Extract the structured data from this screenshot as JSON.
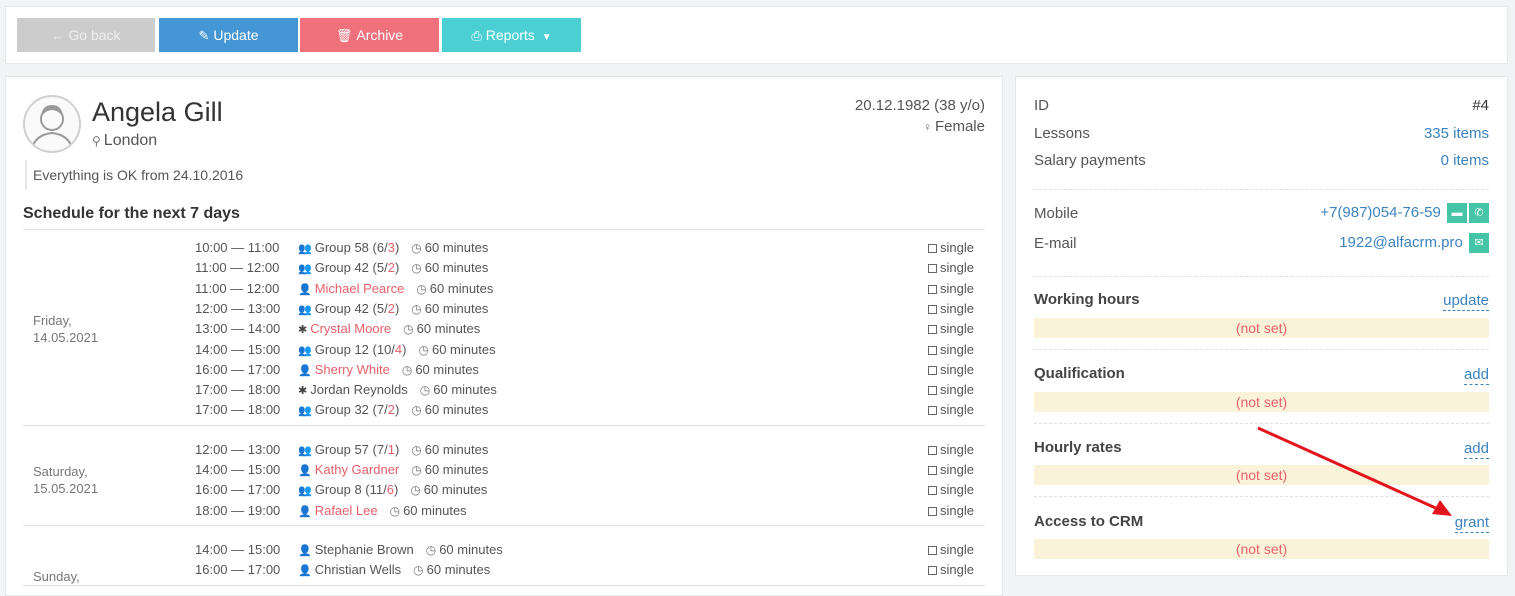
{
  "toolbar": {
    "back_label": "Go back",
    "update_label": "Update",
    "archive_label": "Archive",
    "reports_label": "Reports"
  },
  "profile": {
    "name": "Angela Gill",
    "city": "London",
    "dob": "20.12.1982 (38 y/o)",
    "gender": "Female",
    "status_note": "Everything is OK from 24.10.2016"
  },
  "schedule": {
    "title": "Schedule for the next 7 days",
    "days": [
      {
        "label_line1": "Friday,",
        "label_line2": "14.05.2021",
        "lessons": [
          {
            "time": "10:00 — 11:00",
            "icon": "group-icon",
            "name": "Group 58 (6/",
            "extra": "3",
            "suffix": ")",
            "duration": "60 minutes",
            "type": "single"
          },
          {
            "time": "11:00 — 12:00",
            "icon": "group-icon",
            "name": "Group 42 (5/",
            "extra": "2",
            "suffix": ")",
            "duration": "60 minutes",
            "type": "single"
          },
          {
            "time": "11:00 — 12:00",
            "icon": "user-icon",
            "name": "Michael Pearce",
            "red": true,
            "duration": "60 minutes",
            "type": "single"
          },
          {
            "time": "12:00 — 13:00",
            "icon": "group-icon",
            "name": "Group 42 (5/",
            "extra": "2",
            "suffix": ")",
            "duration": "60 minutes",
            "type": "single"
          },
          {
            "time": "13:00 — 14:00",
            "icon": "asterisk-icon",
            "name": "Crystal Moore",
            "red": true,
            "duration": "60 minutes",
            "type": "single"
          },
          {
            "time": "14:00 — 15:00",
            "icon": "group-icon",
            "name": "Group 12 (10/",
            "extra": "4",
            "suffix": ")",
            "duration": "60 minutes",
            "type": "single"
          },
          {
            "time": "16:00 — 17:00",
            "icon": "user-icon",
            "name": "Sherry White",
            "red": true,
            "duration": "60 minutes",
            "type": "single"
          },
          {
            "time": "17:00 — 18:00",
            "icon": "asterisk-icon",
            "name": "Jordan Reynolds",
            "duration": "60 minutes",
            "type": "single"
          },
          {
            "time": "17:00 — 18:00",
            "icon": "group-icon",
            "name": "Group 32 (7/",
            "extra": "2",
            "suffix": ")",
            "duration": "60 minutes",
            "type": "single"
          }
        ]
      },
      {
        "label_line1": "Saturday,",
        "label_line2": "15.05.2021",
        "lessons": [
          {
            "time": "12:00 — 13:00",
            "icon": "group-icon",
            "name": "Group 57 (7/",
            "extra": "1",
            "suffix": ")",
            "duration": "60 minutes",
            "type": "single"
          },
          {
            "time": "14:00 — 15:00",
            "icon": "user-icon",
            "name": "Kathy Gardner",
            "red": true,
            "duration": "60 minutes",
            "type": "single"
          },
          {
            "time": "16:00 — 17:00",
            "icon": "group-icon",
            "name": "Group 8 (11/",
            "extra": "6",
            "suffix": ")",
            "duration": "60 minutes",
            "type": "single"
          },
          {
            "time": "18:00 — 19:00",
            "icon": "user-icon",
            "name": "Rafael Lee",
            "red": true,
            "duration": "60 minutes",
            "type": "single"
          }
        ]
      },
      {
        "label_line1": "Sunday,",
        "label_line2": "",
        "lessons": [
          {
            "time": "14:00 — 15:00",
            "icon": "user-icon",
            "name": "Stephanie Brown",
            "duration": "60 minutes",
            "type": "single"
          },
          {
            "time": "16:00 — 17:00",
            "icon": "user-icon",
            "name": "Christian Wells",
            "duration": "60 minutes",
            "type": "single"
          }
        ]
      }
    ]
  },
  "details": {
    "id_label": "ID",
    "id_value": "#4",
    "lessons_label": "Lessons",
    "lessons_value": "335 items",
    "salary_label": "Salary payments",
    "salary_value": "0 items",
    "mobile_label": "Mobile",
    "mobile_value": "+7(987)054-76-59",
    "email_label": "E-mail",
    "email_value": "1922@alfacrm.pro"
  },
  "sections": {
    "working_hours": {
      "title": "Working hours",
      "action": "update",
      "value": "(not set)"
    },
    "qualification": {
      "title": "Qualification",
      "action": "add",
      "value": "(not set)"
    },
    "hourly_rates": {
      "title": "Hourly rates",
      "action": "add",
      "value": "(not set)"
    },
    "access_crm": {
      "title": "Access to CRM",
      "action": "grant",
      "value": "(not set)"
    }
  },
  "colors": {
    "update": "#4596d4",
    "archive": "#f0717c",
    "reports": "#4ccfd3",
    "link": "#3b83c0",
    "accent_red": "#e8606a",
    "annotation_arrow": "#e3141d"
  }
}
